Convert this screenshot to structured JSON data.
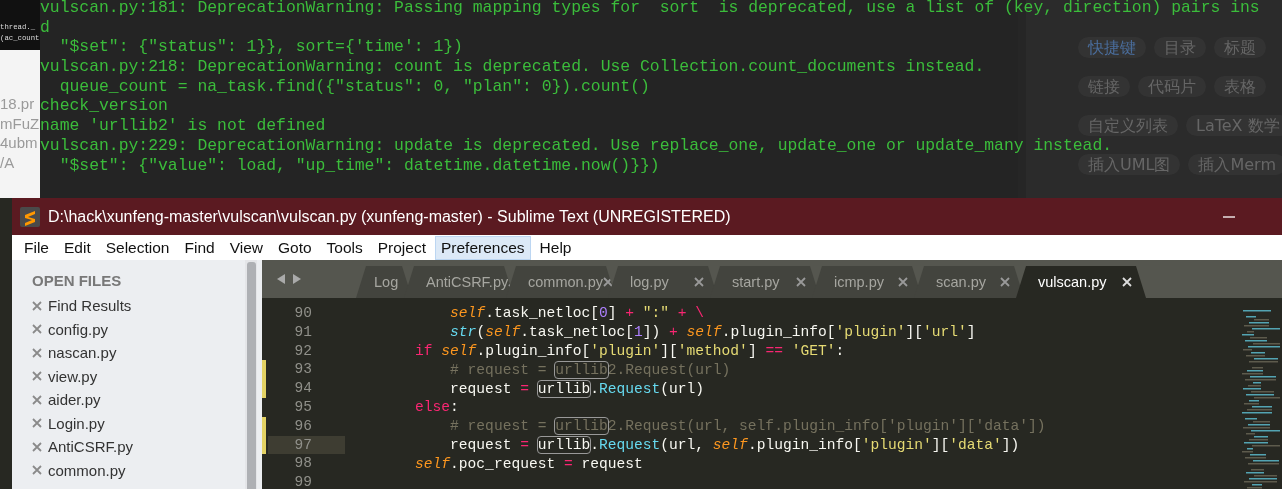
{
  "background_left": {
    "snippet_lines": [
      "thread._",
      "(ac_count"
    ],
    "fragments": [
      "18.pr",
      "mFuZ",
      "4ubm",
      "/A"
    ]
  },
  "editor_toolbar": {
    "rows": [
      [
        {
          "label": "快捷键",
          "highlighted": true
        },
        {
          "label": "目录",
          "highlighted": false
        },
        {
          "label": "标题",
          "highlighted": false
        }
      ],
      [
        {
          "label": "链接",
          "highlighted": false
        },
        {
          "label": "代码片",
          "highlighted": false
        },
        {
          "label": "表格",
          "highlighted": false
        }
      ],
      [
        {
          "label": "自定义列表",
          "highlighted": false
        },
        {
          "label": "LaTeX 数学",
          "highlighted": false
        }
      ],
      [
        {
          "label": "插入UML图",
          "highlighted": false
        },
        {
          "label": "插入Merm",
          "highlighted": false
        }
      ]
    ]
  },
  "terminal": {
    "lines": [
      "vulscan.py:181: DeprecationWarning: Passing mapping types for  sort  is deprecated, use a list of (key, direction) pairs ins",
      "d",
      "  \"$set\": {\"status\": 1}}, sort={'time': 1})",
      "vulscan.py:218: DeprecationWarning: count is deprecated. Use Collection.count_documents instead.",
      "  queue_count = na_task.find({\"status\": 0, \"plan\": 0}).count()",
      "check_version",
      "name 'urllib2' is not defined",
      "vulscan.py:229: DeprecationWarning: update is deprecated. Use replace_one, update_one or update_many instead.",
      "  \"$set\": {\"value\": load, \"up_time\": datetime.datetime.now()}})"
    ]
  },
  "window": {
    "title": "D:\\hack\\xunfeng-master\\vulscan\\vulscan.py (xunfeng-master) - Sublime Text (UNREGISTERED)"
  },
  "menu": [
    {
      "label": "File",
      "selected": false
    },
    {
      "label": "Edit",
      "selected": false
    },
    {
      "label": "Selection",
      "selected": false
    },
    {
      "label": "Find",
      "selected": false
    },
    {
      "label": "View",
      "selected": false
    },
    {
      "label": "Goto",
      "selected": false
    },
    {
      "label": "Tools",
      "selected": false
    },
    {
      "label": "Project",
      "selected": false
    },
    {
      "label": "Preferences",
      "selected": true
    },
    {
      "label": "Help",
      "selected": false
    }
  ],
  "sidebar": {
    "title": "OPEN FILES",
    "items": [
      "Find Results",
      "config.py",
      "nascan.py",
      "view.py",
      "aider.py",
      "Login.py",
      "AntiCSRF.py",
      "common.py"
    ]
  },
  "tabs": [
    {
      "label": "Log",
      "selected": false,
      "kind": "partial"
    },
    {
      "label": "AntiCSRF.py",
      "selected": false,
      "kind": "full"
    },
    {
      "label": "common.py",
      "selected": false,
      "kind": "full"
    },
    {
      "label": "log.py",
      "selected": false,
      "kind": "full"
    },
    {
      "label": "start.py",
      "selected": false,
      "kind": "full"
    },
    {
      "label": "icmp.py",
      "selected": false,
      "kind": "full"
    },
    {
      "label": "scan.py",
      "selected": false,
      "kind": "full"
    },
    {
      "label": "vulscan.py",
      "selected": true,
      "kind": "full"
    }
  ],
  "code": [
    {
      "number": "90",
      "modified": false,
      "current": false,
      "tokens": [
        {
          "kind": "self",
          "text": "            self"
        },
        {
          "kind": "plain",
          "text": ".task_netloc["
        },
        {
          "kind": "number",
          "text": "0"
        },
        {
          "kind": "plain",
          "text": "] "
        },
        {
          "kind": "operator",
          "text": "+ "
        },
        {
          "kind": "string",
          "text": "\":\""
        },
        {
          "kind": "operator",
          "text": " + \\"
        }
      ]
    },
    {
      "number": "91",
      "modified": false,
      "current": false,
      "tokens": [
        {
          "kind": "builtin",
          "text": "            str"
        },
        {
          "kind": "plain",
          "text": "("
        },
        {
          "kind": "self",
          "text": "self"
        },
        {
          "kind": "plain",
          "text": ".task_netloc["
        },
        {
          "kind": "number",
          "text": "1"
        },
        {
          "kind": "plain",
          "text": "]) "
        },
        {
          "kind": "operator",
          "text": "+ "
        },
        {
          "kind": "self",
          "text": "self"
        },
        {
          "kind": "plain",
          "text": ".plugin_info["
        },
        {
          "kind": "string",
          "text": "'plugin'"
        },
        {
          "kind": "plain",
          "text": "]["
        },
        {
          "kind": "string",
          "text": "'url'"
        },
        {
          "kind": "plain",
          "text": "]"
        }
      ]
    },
    {
      "number": "92",
      "modified": false,
      "current": false,
      "tokens": [
        {
          "kind": "keyword",
          "text": "        if "
        },
        {
          "kind": "self",
          "text": "self"
        },
        {
          "kind": "plain",
          "text": ".plugin_info["
        },
        {
          "kind": "string",
          "text": "'plugin'"
        },
        {
          "kind": "plain",
          "text": "]["
        },
        {
          "kind": "string",
          "text": "'method'"
        },
        {
          "kind": "plain",
          "text": "] "
        },
        {
          "kind": "operator",
          "text": "== "
        },
        {
          "kind": "string",
          "text": "'GET'"
        },
        {
          "kind": "plain",
          "text": ":"
        }
      ]
    },
    {
      "number": "93",
      "modified": true,
      "current": false,
      "tokens": [
        {
          "kind": "comment",
          "text": "            # request = "
        },
        {
          "kind": "match-comment",
          "text": "urllib"
        },
        {
          "kind": "comment",
          "text": "2.Request(url)"
        }
      ]
    },
    {
      "number": "94",
      "modified": true,
      "current": false,
      "tokens": [
        {
          "kind": "plain",
          "text": "            request "
        },
        {
          "kind": "operator",
          "text": "= "
        },
        {
          "kind": "match",
          "text": "urllib"
        },
        {
          "kind": "plain",
          "text": "."
        },
        {
          "kind": "call",
          "text": "Request"
        },
        {
          "kind": "plain",
          "text": "(url)"
        }
      ]
    },
    {
      "number": "95",
      "modified": false,
      "current": false,
      "tokens": [
        {
          "kind": "keyword",
          "text": "        else"
        },
        {
          "kind": "plain",
          "text": ":"
        }
      ]
    },
    {
      "number": "96",
      "modified": true,
      "current": false,
      "tokens": [
        {
          "kind": "comment",
          "text": "            # request = "
        },
        {
          "kind": "match-comment",
          "text": "urllib"
        },
        {
          "kind": "comment",
          "text": "2.Request(url, self.plugin_info['plugin']['data'])"
        }
      ]
    },
    {
      "number": "97",
      "modified": true,
      "current": true,
      "tokens": [
        {
          "kind": "plain",
          "text": "            request "
        },
        {
          "kind": "operator",
          "text": "= "
        },
        {
          "kind": "match",
          "text": "urllib"
        },
        {
          "kind": "plain",
          "text": "."
        },
        {
          "kind": "call",
          "text": "Request"
        },
        {
          "kind": "plain",
          "text": "(url, "
        },
        {
          "kind": "self",
          "text": "self"
        },
        {
          "kind": "plain",
          "text": ".plugin_info["
        },
        {
          "kind": "string",
          "text": "'plugin'"
        },
        {
          "kind": "plain",
          "text": "]["
        },
        {
          "kind": "string",
          "text": "'data'"
        },
        {
          "kind": "plain",
          "text": "])"
        }
      ]
    },
    {
      "number": "98",
      "modified": false,
      "current": false,
      "tokens": [
        {
          "kind": "self",
          "text": "        self"
        },
        {
          "kind": "plain",
          "text": ".poc_request "
        },
        {
          "kind": "operator",
          "text": "= "
        },
        {
          "kind": "plain",
          "text": "request"
        }
      ]
    },
    {
      "number": "99",
      "modified": false,
      "current": false
    }
  ]
}
